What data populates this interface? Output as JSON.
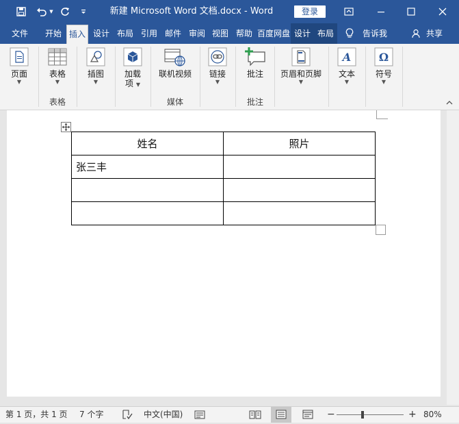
{
  "window": {
    "title": "新建 Microsoft Word 文档.docx  -  Word",
    "login_label": "登录"
  },
  "tabs": [
    {
      "label": "文件"
    },
    {
      "label": "开始"
    },
    {
      "label": "插入"
    },
    {
      "label": "设计"
    },
    {
      "label": "布局"
    },
    {
      "label": "引用"
    },
    {
      "label": "邮件"
    },
    {
      "label": "审阅"
    },
    {
      "label": "视图"
    },
    {
      "label": "帮助"
    },
    {
      "label": "百度网盘"
    },
    {
      "label": "设计"
    },
    {
      "label": "布局"
    }
  ],
  "tell_me": "告诉我",
  "share": "共享",
  "ribbon": {
    "buttons": {
      "page": "页面",
      "table": "表格",
      "illustrations": "插图",
      "addins_1": "加载",
      "addins_2": "项",
      "online_video": "联机视频",
      "link": "链接",
      "comment": "批注",
      "header_footer": "页眉和页脚",
      "text": "文本",
      "symbol": "符号"
    },
    "groups": {
      "table": "表格",
      "media": "媒体",
      "comments": "批注"
    }
  },
  "document": {
    "table": {
      "headers": [
        "姓名",
        "照片"
      ],
      "rows": [
        [
          "张三丰",
          ""
        ],
        [
          "",
          ""
        ],
        [
          "",
          ""
        ]
      ]
    }
  },
  "statusbar": {
    "page": "第 1 页，共 1 页",
    "words": "7 个字",
    "language": "中文(中国)",
    "zoom": "80%",
    "zoom_value": 80
  }
}
